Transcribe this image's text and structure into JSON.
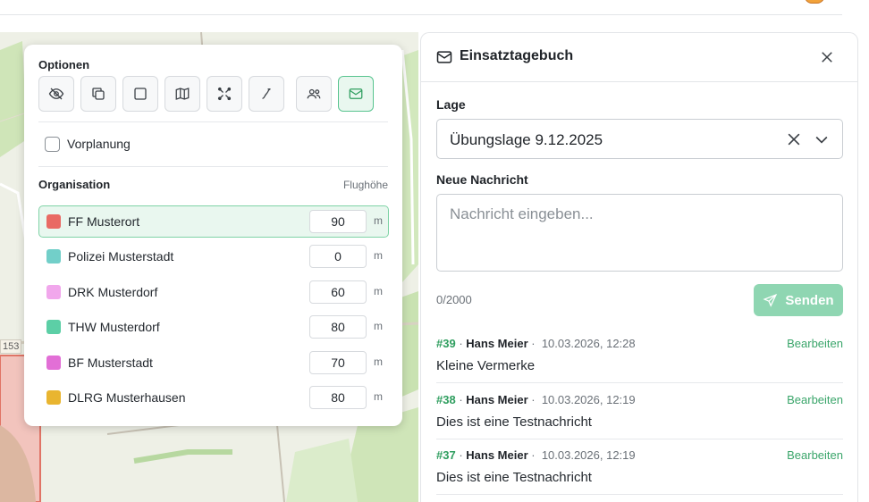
{
  "options": {
    "title": "Optionen",
    "tools": [
      {
        "icon": "eye-off-icon",
        "active": false
      },
      {
        "icon": "layers-copy-icon",
        "active": false
      },
      {
        "icon": "square-icon",
        "active": false
      },
      {
        "icon": "map-icon",
        "active": false
      },
      {
        "icon": "arrows-expand-icon",
        "active": false
      },
      {
        "icon": "path-curve-icon",
        "active": false
      },
      {
        "icon": "users-icon",
        "active": false
      },
      {
        "icon": "mail-icon",
        "active": true
      }
    ],
    "vorplanung_label": "Vorplanung",
    "vorplanung_checked": false,
    "organisation_title": "Organisation",
    "height_title": "Flughöhe",
    "unit": "m",
    "organisations": [
      {
        "name": "FF Musterort",
        "height": "90",
        "color": "#e96a64",
        "selected": true
      },
      {
        "name": "Polizei Musterstadt",
        "height": "0",
        "color": "#72cfc9",
        "selected": false
      },
      {
        "name": "DRK Musterdorf",
        "height": "60",
        "color": "#f1a7ec",
        "selected": false
      },
      {
        "name": "THW Musterdorf",
        "height": "80",
        "color": "#5ccfa6",
        "selected": false
      },
      {
        "name": "BF Musterstadt",
        "height": "70",
        "color": "#e26fd6",
        "selected": false
      },
      {
        "name": "DLRG Musterhausen",
        "height": "80",
        "color": "#e9b530",
        "selected": false
      }
    ]
  },
  "map": {
    "scale_label": "153"
  },
  "diary": {
    "title": "Einsatztagebuch",
    "lage_label": "Lage",
    "lage_value": "Übungslage 9.12.2025",
    "message_label": "Neue Nachricht",
    "message_placeholder": "Nachricht eingeben...",
    "counter": "0/2000",
    "send_label": "Senden",
    "edit_label": "Bearbeiten",
    "entries": [
      {
        "num": "#39",
        "author": "Hans Meier",
        "time": "10.03.2026, 12:28",
        "message": "Kleine Vermerke"
      },
      {
        "num": "#38",
        "author": "Hans Meier",
        "time": "10.03.2026, 12:19",
        "message": "Dies ist eine Testnachricht"
      },
      {
        "num": "#37",
        "author": "Hans Meier",
        "time": "10.03.2026, 12:19",
        "message": "Dies ist eine Testnachricht"
      }
    ]
  },
  "colors": {
    "accent": "#3aa56a",
    "accent_light": "#8fd6b2",
    "selected_bg": "#e9f7ef"
  }
}
